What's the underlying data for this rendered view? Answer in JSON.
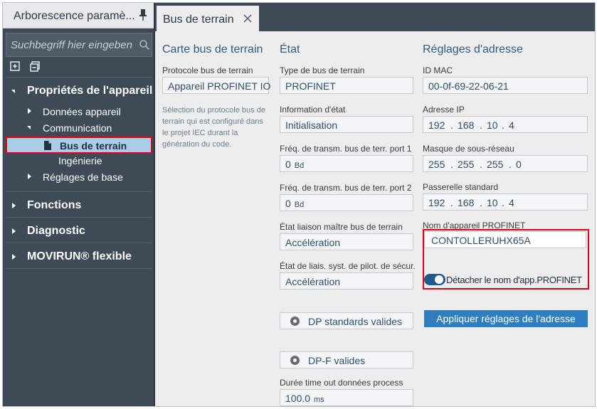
{
  "left_panel": {
    "title": "Arborescence paramè...",
    "search_placeholder": "Suchbegriff hier eingeben",
    "tree": {
      "device_properties": "Propriétés de l'appareil",
      "device_data": "Données appareil",
      "communication": "Communication",
      "fieldbus": "Bus de terrain",
      "engineering": "Ingénierie",
      "basic_settings": "Réglages de base",
      "functions": "Fonctions",
      "diagnostics": "Diagnostic",
      "movirun": "MOVIRUN® flexible"
    }
  },
  "tab": {
    "label": "Bus de terrain"
  },
  "col1": {
    "title": "Carte bus de terrain",
    "protocol_label": "Protocole bus de terrain",
    "protocol_value": "Appareil PROFINET IO",
    "description": "Sélection du protocole bus de terrain qui est configuré dans le projet IEC durant la génération du code."
  },
  "col2": {
    "title": "État",
    "fieldbus_type_label": "Type de bus de terrain",
    "fieldbus_type_value": "PROFINET",
    "status_label": "Information d'état",
    "status_value": "Initialisation",
    "baud_port1_label": "Fréq. de transm. bus de terr. port 1",
    "baud_port1_value": "0",
    "baud_port2_label": "Fréq. de transm. bus de terr. port 2",
    "baud_port2_value": "0",
    "baud_unit": "Bd",
    "master_link_label": "État liaison maître bus de terrain",
    "master_link_value": "Accélération",
    "safety_link_label": "État de liais. syst. de pilot. de sécur.",
    "safety_link_value": "Accélération",
    "dp_standard_label": "DP standards valides",
    "dpf_label": "DP-F valides",
    "timeout_label": "Durée time out données process",
    "timeout_value": "100.0",
    "timeout_unit": "ms"
  },
  "col3": {
    "title": "Réglages d'adresse",
    "mac_label": "ID MAC",
    "mac_value": "00-0f-69-22-06-21",
    "ip_label": "Adresse IP",
    "ip": [
      "192",
      "168",
      "10",
      "4"
    ],
    "subnet_label": "Masque de sous-réseau",
    "subnet": [
      "255",
      "255",
      "255",
      "0"
    ],
    "gateway_label": "Passerelle standard",
    "gateway": [
      "192",
      "168",
      "10",
      "4"
    ],
    "ip_dot": ".",
    "device_name_label": "Nom d'appareil PROFINET",
    "device_name_value": "CONTOLLERUHX65A",
    "toggle_label": "Détacher le nom d'app.PROFINET",
    "apply_label": "Appliquer réglages de l'adresse"
  },
  "colors": {
    "accent": "#2f7fc0",
    "highlight": "#e2001a",
    "panel": "#3e4a55",
    "selection": "#a9cde7"
  }
}
